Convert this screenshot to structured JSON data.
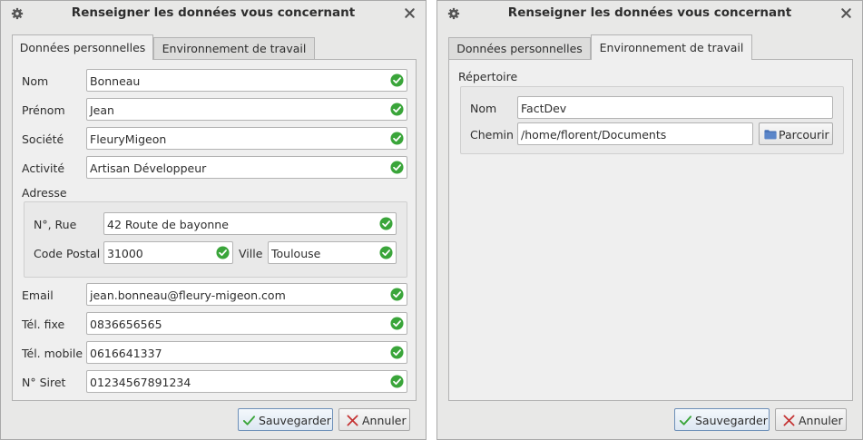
{
  "dialog_title": "Renseigner les données vous concernant",
  "tabs": {
    "personal": "Données personnelles",
    "work_env": "Environnement de travail"
  },
  "personal": {
    "nom": {
      "label": "Nom",
      "value": "Bonneau"
    },
    "prenom": {
      "label": "Prénom",
      "value": "Jean"
    },
    "societe": {
      "label": "Société",
      "value": "FleuryMigeon"
    },
    "activite": {
      "label": "Activité",
      "value": "Artisan Développeur"
    },
    "address_group": "Adresse",
    "rue": {
      "label": "N°, Rue",
      "value": "42 Route de bayonne"
    },
    "code_postal": {
      "label": "Code Postal",
      "value": "31000"
    },
    "ville": {
      "label": "Ville",
      "value": "Toulouse"
    },
    "email": {
      "label": "Email",
      "value": "jean.bonneau@fleury-migeon.com"
    },
    "tel_fixe": {
      "label": "Tél. fixe",
      "value": "0836656565"
    },
    "tel_mobile": {
      "label": "Tél. mobile",
      "value": "0616641337"
    },
    "siret": {
      "label": "N° Siret",
      "value": "01234567891234"
    }
  },
  "work_env": {
    "group": "Répertoire",
    "nom": {
      "label": "Nom",
      "value": "FactDev"
    },
    "chemin": {
      "label": "Chemin",
      "value": "/home/florent/Documents"
    },
    "browse_label": "Parcourir"
  },
  "buttons": {
    "save": "Sauvegarder",
    "cancel": "Annuler"
  },
  "icons": {
    "valid": "check-circle-icon",
    "settings": "gear-icon",
    "close": "close-icon",
    "folder": "folder-icon",
    "save_check": "check-icon",
    "cancel_x": "cancel-icon"
  },
  "colors": {
    "valid_green": "#3aa53a",
    "folder_blue": "#4a74b8",
    "cancel_red": "#c43030",
    "save_green": "#3aa53a"
  }
}
